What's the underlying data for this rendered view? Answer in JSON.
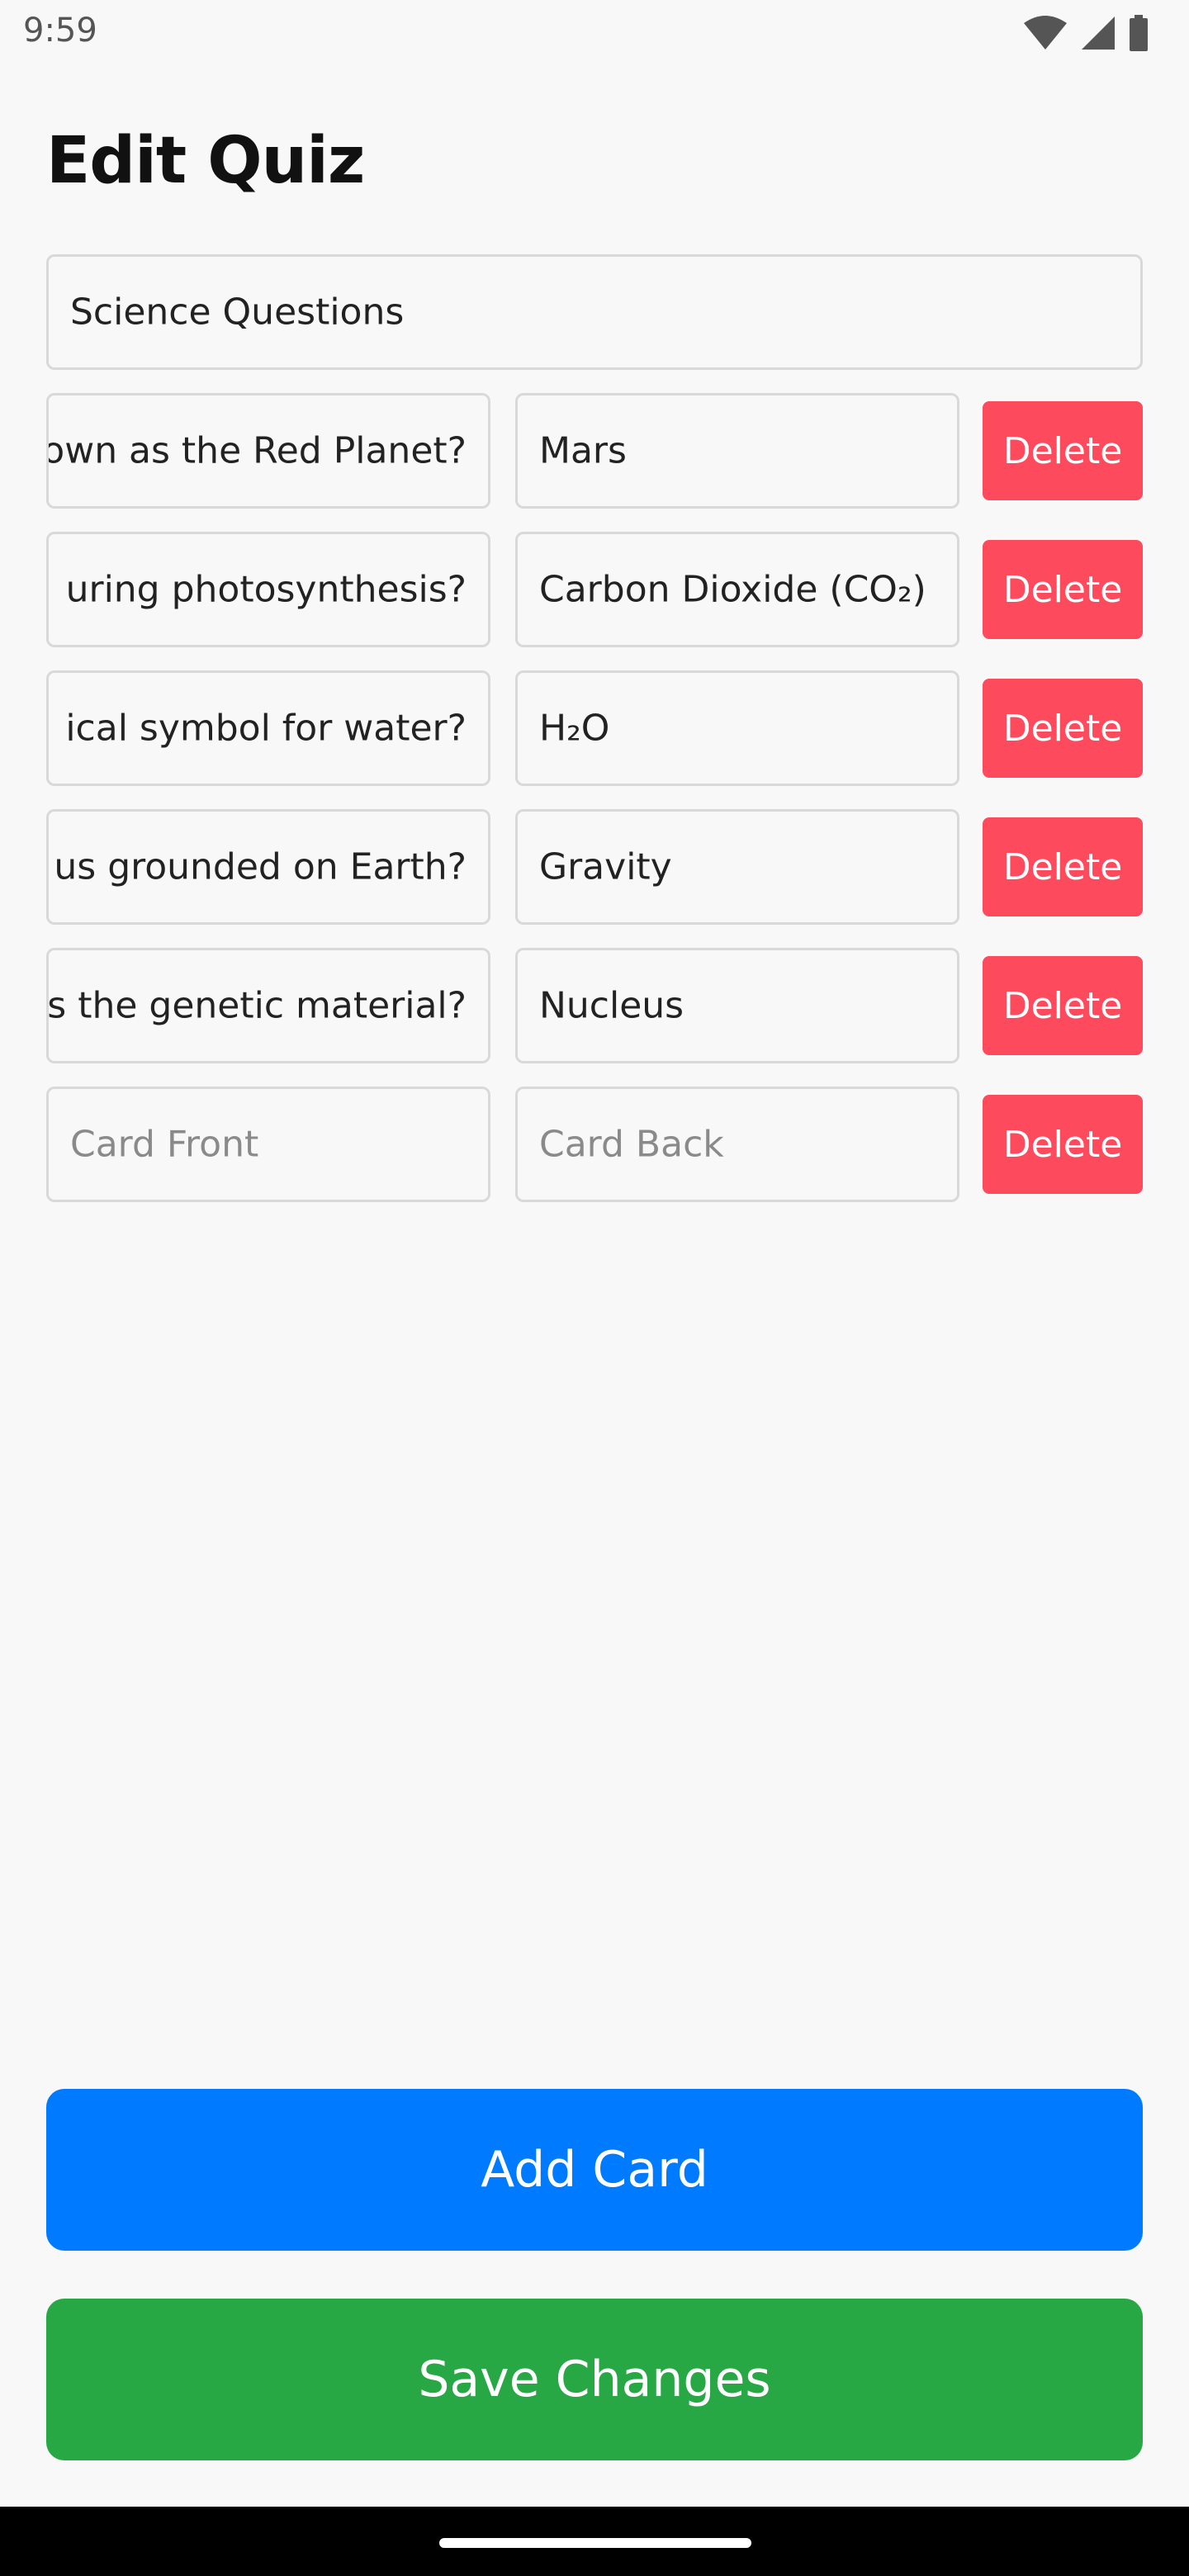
{
  "status_bar": {
    "time": "9:59",
    "icons": [
      "wifi-icon",
      "signal-icon",
      "battery-icon"
    ]
  },
  "header": {
    "title": "Edit Quiz"
  },
  "quiz": {
    "title_value": "Science Questions"
  },
  "cards": [
    {
      "front": "own as the Red Planet?",
      "back": "Mars",
      "delete_label": "Delete"
    },
    {
      "front": "uring photosynthesis?",
      "back": "Carbon Dioxide (CO₂)",
      "delete_label": "Delete"
    },
    {
      "front": "ical symbol for water?",
      "back": "H₂O",
      "delete_label": "Delete"
    },
    {
      "front": "us grounded on Earth?",
      "back": "Gravity",
      "delete_label": "Delete"
    },
    {
      "front": "s the genetic material?",
      "back": "Nucleus",
      "delete_label": "Delete"
    },
    {
      "front": "",
      "back": "",
      "front_placeholder": "Card Front",
      "back_placeholder": "Card Back",
      "delete_label": "Delete"
    }
  ],
  "actions": {
    "add_card_label": "Add Card",
    "save_label": "Save Changes"
  },
  "colors": {
    "delete": "#fd4a5c",
    "add": "#007bff",
    "save": "#28a745"
  }
}
